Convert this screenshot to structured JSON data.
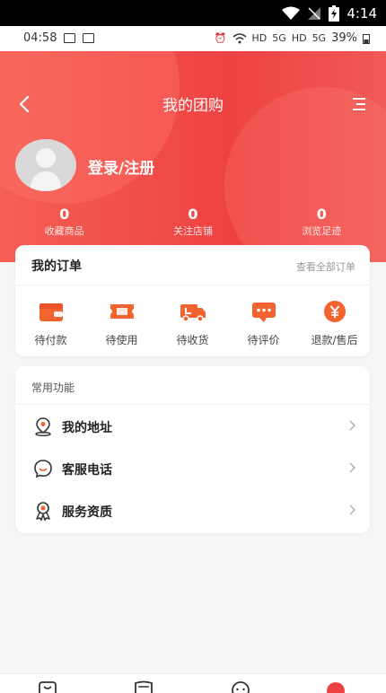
{
  "system_bar": {
    "time": "4:14"
  },
  "phone_status": {
    "time": "04:58",
    "battery": "39%",
    "hd1": "HD",
    "hd2": "HD",
    "net1": "5G",
    "net2": "5G"
  },
  "header": {
    "title": "我的团购"
  },
  "profile": {
    "login_label": "登录/注册"
  },
  "stats": [
    {
      "value": "0",
      "label": "收藏商品"
    },
    {
      "value": "0",
      "label": "关注店铺"
    },
    {
      "value": "0",
      "label": "浏览足迹"
    }
  ],
  "orders": {
    "title": "我的订单",
    "view_all": "查看全部订单",
    "items": [
      {
        "label": "待付款",
        "icon": "wallet-icon"
      },
      {
        "label": "待使用",
        "icon": "ticket-icon"
      },
      {
        "label": "待收货",
        "icon": "truck-icon"
      },
      {
        "label": "待评价",
        "icon": "comment-icon"
      },
      {
        "label": "退款/售后",
        "icon": "yen-icon"
      }
    ]
  },
  "common": {
    "title": "常用功能",
    "items": [
      {
        "label": "我的地址",
        "icon": "location-icon"
      },
      {
        "label": "客服电话",
        "icon": "customer-service-icon"
      },
      {
        "label": "服务资质",
        "icon": "award-icon"
      }
    ]
  },
  "colors": {
    "brand": "#ee4242",
    "icon_orange": "#f2642f"
  }
}
